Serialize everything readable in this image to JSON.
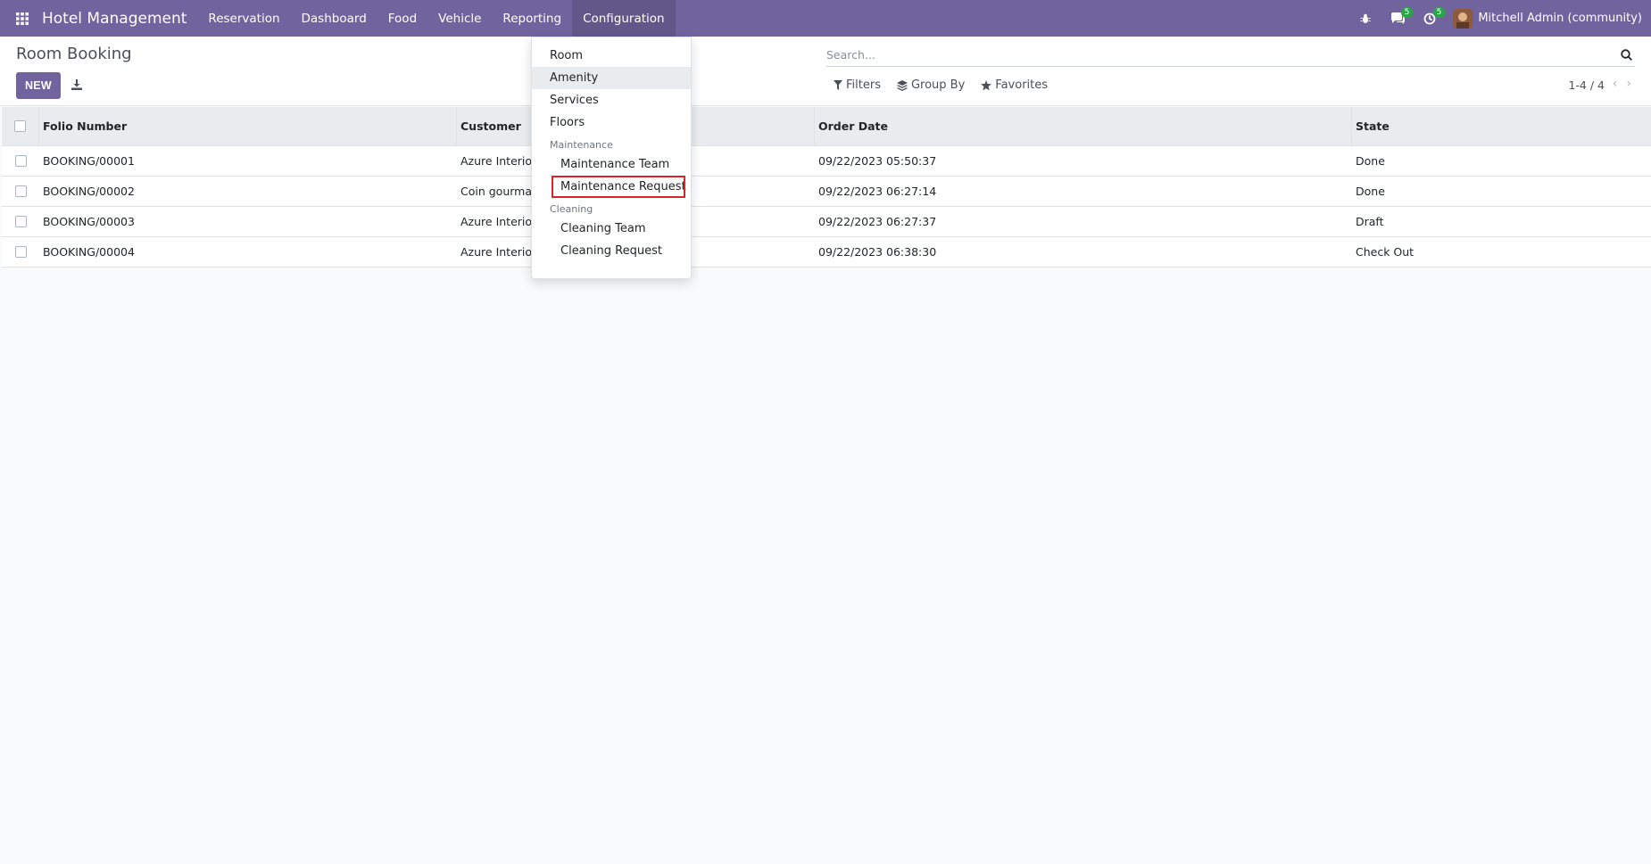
{
  "navbar": {
    "brand": "Hotel Management",
    "menu": [
      {
        "label": "Reservation"
      },
      {
        "label": "Dashboard"
      },
      {
        "label": "Food"
      },
      {
        "label": "Vehicle"
      },
      {
        "label": "Reporting"
      },
      {
        "label": "Configuration"
      }
    ],
    "messages_count": "5",
    "activities_count": "5",
    "user_name": "Mitchell Admin (community)"
  },
  "control_panel": {
    "breadcrumb": "Room Booking",
    "new_label": "NEW",
    "search_placeholder": "Search...",
    "filters_label": "Filters",
    "group_by_label": "Group By",
    "favorites_label": "Favorites",
    "pager": "1-4 / 4"
  },
  "table": {
    "headers": [
      "Folio Number",
      "Customer",
      "Order Date",
      "State"
    ],
    "rows": [
      [
        "BOOKING/00001",
        "Azure Interior",
        "09/22/2023 05:50:37",
        "Done"
      ],
      [
        "BOOKING/00002",
        "Coin gourman",
        "09/22/2023 06:27:14",
        "Done"
      ],
      [
        "BOOKING/00003",
        "Azure Interior",
        "09/22/2023 06:27:37",
        "Draft"
      ],
      [
        "BOOKING/00004",
        "Azure Interior",
        "09/22/2023 06:38:30",
        "Check Out"
      ]
    ]
  },
  "dropdown": {
    "room": "Room",
    "amenity": "Amenity",
    "services": "Services",
    "floors": "Floors",
    "maintenance_header": "Maintenance",
    "maintenance_team": "Maintenance Team",
    "maintenance_request": "Maintenance Request",
    "cleaning_header": "Cleaning",
    "cleaning_team": "Cleaning Team",
    "cleaning_request": "Cleaning Request"
  },
  "colors": {
    "brand": "#71639e",
    "badge": "#28a745",
    "highlight": "#d9242a"
  }
}
